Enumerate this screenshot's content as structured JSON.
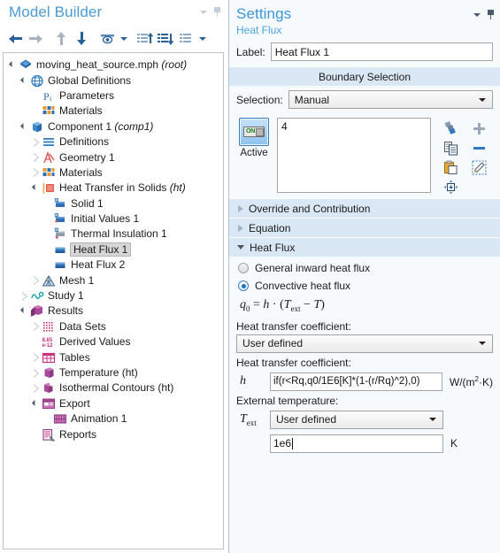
{
  "model_builder": {
    "title": "Model Builder",
    "titlebar_icons": [
      "chevron-down-icon",
      "pin-icon"
    ],
    "toolbar": [
      {
        "name": "back-arrow-icon",
        "label": "Back"
      },
      {
        "name": "forward-arrow-icon",
        "label": "Forward"
      },
      {
        "name": "move-up-icon",
        "label": "Move Up"
      },
      {
        "name": "move-down-icon",
        "label": "Move Down"
      },
      {
        "name": "show-hide-icon",
        "label": "Show"
      },
      {
        "name": "show-dropdown-caret-icon",
        "label": "Show options"
      },
      {
        "name": "expand-all-icon",
        "label": "Expand All"
      },
      {
        "name": "collapse-all-icon",
        "label": "Collapse All"
      },
      {
        "name": "list-view-icon",
        "label": "View"
      },
      {
        "name": "list-dropdown-caret-icon",
        "label": "View options"
      }
    ],
    "tree": [
      {
        "label": "moving_heat_source.mph",
        "suffix": "(root)",
        "indent": 0,
        "expander": "open",
        "icon": "comsol-root-icon",
        "selected": false
      },
      {
        "label": "Global Definitions",
        "suffix": "",
        "indent": 1,
        "expander": "open",
        "icon": "globe-icon",
        "selected": false
      },
      {
        "label": "Parameters",
        "suffix": "",
        "indent": 2,
        "expander": "none",
        "icon": "parameters-pi-icon",
        "selected": false
      },
      {
        "label": "Materials",
        "suffix": "",
        "indent": 2,
        "expander": "none",
        "icon": "materials-icon",
        "selected": false
      },
      {
        "label": "Component 1",
        "suffix": "(comp1)",
        "indent": 1,
        "expander": "open",
        "icon": "component-icon",
        "selected": false
      },
      {
        "label": "Definitions",
        "suffix": "",
        "indent": 2,
        "expander": "closed",
        "icon": "definitions-icon",
        "selected": false
      },
      {
        "label": "Geometry 1",
        "suffix": "",
        "indent": 2,
        "expander": "closed",
        "icon": "geometry-icon",
        "selected": false
      },
      {
        "label": "Materials",
        "suffix": "",
        "indent": 2,
        "expander": "closed",
        "icon": "materials-icon",
        "selected": false
      },
      {
        "label": "Heat Transfer in Solids",
        "suffix": "(ht)",
        "indent": 2,
        "expander": "open",
        "icon": "heat-transfer-icon",
        "selected": false
      },
      {
        "label": "Solid 1",
        "suffix": "",
        "indent": 3,
        "expander": "none",
        "icon": "solid-icon",
        "selected": false
      },
      {
        "label": "Initial Values 1",
        "suffix": "",
        "indent": 3,
        "expander": "none",
        "icon": "initial-values-icon",
        "selected": false
      },
      {
        "label": "Thermal Insulation 1",
        "suffix": "",
        "indent": 3,
        "expander": "none",
        "icon": "thermal-insulation-icon",
        "selected": false
      },
      {
        "label": "Heat Flux 1",
        "suffix": "",
        "indent": 3,
        "expander": "none",
        "icon": "heat-flux-icon",
        "selected": true
      },
      {
        "label": "Heat Flux 2",
        "suffix": "",
        "indent": 3,
        "expander": "none",
        "icon": "heat-flux-icon",
        "selected": false
      },
      {
        "label": "Mesh 1",
        "suffix": "",
        "indent": 2,
        "expander": "closed",
        "icon": "mesh-icon",
        "selected": false
      },
      {
        "label": "Study 1",
        "suffix": "",
        "indent": 1,
        "expander": "closed",
        "icon": "study-icon",
        "selected": false
      },
      {
        "label": "Results",
        "suffix": "",
        "indent": 1,
        "expander": "open",
        "icon": "results-icon",
        "selected": false
      },
      {
        "label": "Data Sets",
        "suffix": "",
        "indent": 2,
        "expander": "closed",
        "icon": "data-sets-icon",
        "selected": false
      },
      {
        "label": "Derived Values",
        "suffix": "",
        "indent": 2,
        "expander": "none",
        "icon": "derived-values-icon",
        "selected": false
      },
      {
        "label": "Tables",
        "suffix": "",
        "indent": 2,
        "expander": "closed",
        "icon": "tables-icon",
        "selected": false
      },
      {
        "label": "Temperature (ht)",
        "suffix": "",
        "indent": 2,
        "expander": "closed",
        "icon": "temperature-plot-icon",
        "selected": false
      },
      {
        "label": "Isothermal Contours (ht)",
        "suffix": "",
        "indent": 2,
        "expander": "closed",
        "icon": "isothermal-contours-icon",
        "selected": false
      },
      {
        "label": "Export",
        "suffix": "",
        "indent": 2,
        "expander": "open",
        "icon": "export-icon",
        "selected": false
      },
      {
        "label": "Animation 1",
        "suffix": "",
        "indent": 3,
        "expander": "none",
        "icon": "animation-icon",
        "selected": false
      },
      {
        "label": "Reports",
        "suffix": "",
        "indent": 2,
        "expander": "none",
        "icon": "reports-icon",
        "selected": false
      }
    ]
  },
  "settings": {
    "title": "Settings",
    "subtitle": "Heat Flux",
    "label_caption": "Label:",
    "label_value": "Heat Flux 1",
    "boundary_selection": {
      "header": "Boundary Selection",
      "selection_caption": "Selection:",
      "selection_value": "Manual",
      "active_label": "Active",
      "active_state": "ON",
      "list_items": [
        "4"
      ],
      "tools": [
        "create-selection-icon",
        "add-to-selection-icon",
        "copy-selection-icon",
        "remove-from-selection-icon",
        "paste-selection-icon",
        "clear-selection-icon",
        "zoom-to-selection-icon"
      ]
    },
    "sections": [
      {
        "name": "override-and-contribution",
        "title": "Override and Contribution",
        "expanded": false
      },
      {
        "name": "equation",
        "title": "Equation",
        "expanded": false
      },
      {
        "name": "heat-flux",
        "title": "Heat Flux",
        "expanded": true
      }
    ],
    "heat_flux": {
      "options": [
        {
          "label": "General inward heat flux",
          "selected": false
        },
        {
          "label": "Convective heat flux",
          "selected": true
        }
      ],
      "equation": "q0 = h · (Text - T)",
      "htc_caption": "Heat transfer coefficient:",
      "htc_mode": "User defined",
      "htc_value_caption": "Heat transfer coefficient:",
      "htc_symbol": "h",
      "htc_value": "if(r<Rq,q0/1E6[K]*(1-(r/Rq)^2),0)",
      "htc_unit": "W/(m2·K)",
      "ext_temp_caption": "External temperature:",
      "ext_temp_symbol": "Text",
      "ext_temp_mode": "User defined",
      "ext_temp_value": "1e6",
      "ext_temp_unit": "K"
    }
  },
  "colors": {
    "title_blue": "#3b97de",
    "section_header_bg": "#dae8f5",
    "panel_bg": "#f7fafd",
    "selection_highlight": "#d6d6d6",
    "accent_blue": "#2a6099",
    "active_button_blue": "#8cc2ef"
  }
}
